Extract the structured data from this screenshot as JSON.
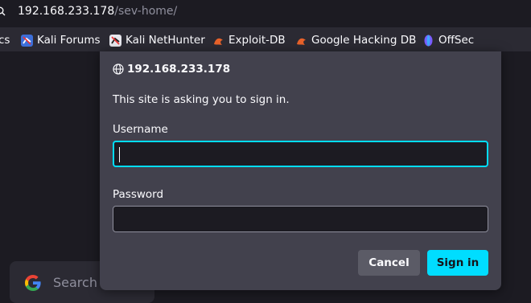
{
  "urlbar": {
    "host": "192.168.233.178",
    "path": "/sev-home/"
  },
  "bookmarks": [
    {
      "label": "cs",
      "icon": "truncated-bookmark"
    },
    {
      "label": "Kali Forums",
      "icon": "kali-forums-icon"
    },
    {
      "label": "Kali NetHunter",
      "icon": "kali-nethunter-icon"
    },
    {
      "label": "Exploit-DB",
      "icon": "exploit-db-icon"
    },
    {
      "label": "Google Hacking DB",
      "icon": "exploit-db-icon"
    },
    {
      "label": "OffSec",
      "icon": "offsec-icon"
    }
  ],
  "page": {
    "search_placeholder": "Search"
  },
  "dialog": {
    "host": "192.168.233.178",
    "message": "This site is asking you to sign in.",
    "username_label": "Username",
    "username_value": "",
    "password_label": "Password",
    "password_value": "",
    "cancel_label": "Cancel",
    "signin_label": "Sign in"
  },
  "colors": {
    "accent": "#00ddff",
    "dialog_bg": "#42414d",
    "toolbar_bg": "#2b2a33",
    "page_bg": "#1c1b22"
  }
}
